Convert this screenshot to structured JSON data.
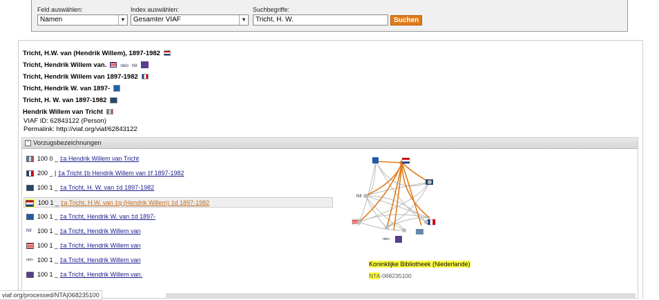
{
  "search": {
    "field_label": "Feld auswählen:",
    "field_value": "Namen",
    "index_label": "Index auswählen:",
    "index_value": "Gesamter VIAF",
    "terms_label": "Suchbegriffe:",
    "terms_value": "Tricht, H. W.",
    "button_label": "Suchen"
  },
  "headings": [
    "Tricht, H.W. van (Hendrik Willem), 1897-1982",
    "Tricht, Hendrik Willem van.",
    "Tricht, Hendrik Willem van 1897-1982",
    "Tricht, Hendrik W. van 1897-",
    "Tricht, H. W. van 1897-1982",
    "Hendrik Willem van Tricht"
  ],
  "viaf_id": "VIAF ID: 62843122 (Person)",
  "permalink": "Permalink: http://viaf.org/viaf/62843122",
  "section_title": "Vorzugsbezeichnungen",
  "rows": [
    {
      "code": "100 0 _",
      "link": "‡a  Hendrik Willem van Tricht"
    },
    {
      "code": "200 _ |",
      "link": "‡a  Tricht ‡b  Hendrik Willem van ‡f  1897-1982"
    },
    {
      "code": "100 1 _",
      "link": "‡a  Tricht, H. W. van ‡d  1897-1982"
    },
    {
      "code": "100 1 _",
      "link": "‡a  Tricht, H.W. van ‡q  (Hendrik Willem) ‡d  1897-1982"
    },
    {
      "code": "100 1 _",
      "link": "‡a  Tricht, Hendrik W. van ‡d  1897-"
    },
    {
      "code": "100 1 _",
      "link": "‡a  Tricht, Hendrik Willem van"
    },
    {
      "code": "100 1 _",
      "link": "‡a  Tricht, Hendrik Willem van"
    },
    {
      "code": "100 1 _",
      "link": "‡a  Tricht, Hendrik Willem van"
    },
    {
      "code": "100 1 _",
      "link": "‡a  Tricht, Hendrik Willem van."
    }
  ],
  "graph_labels": {
    "nii": "NII",
    "nfgo": "nb/o"
  },
  "source_name": "Koninklijke Bibliotheek (Niederlande)",
  "source_prefix": "NTA",
  "source_id": "-068235100",
  "status_url": "viaf.org/processed/NTA|068235100",
  "colors": {
    "accent": "#e07b1a",
    "link": "#1a1a8c",
    "highlight": "#ffff33"
  }
}
